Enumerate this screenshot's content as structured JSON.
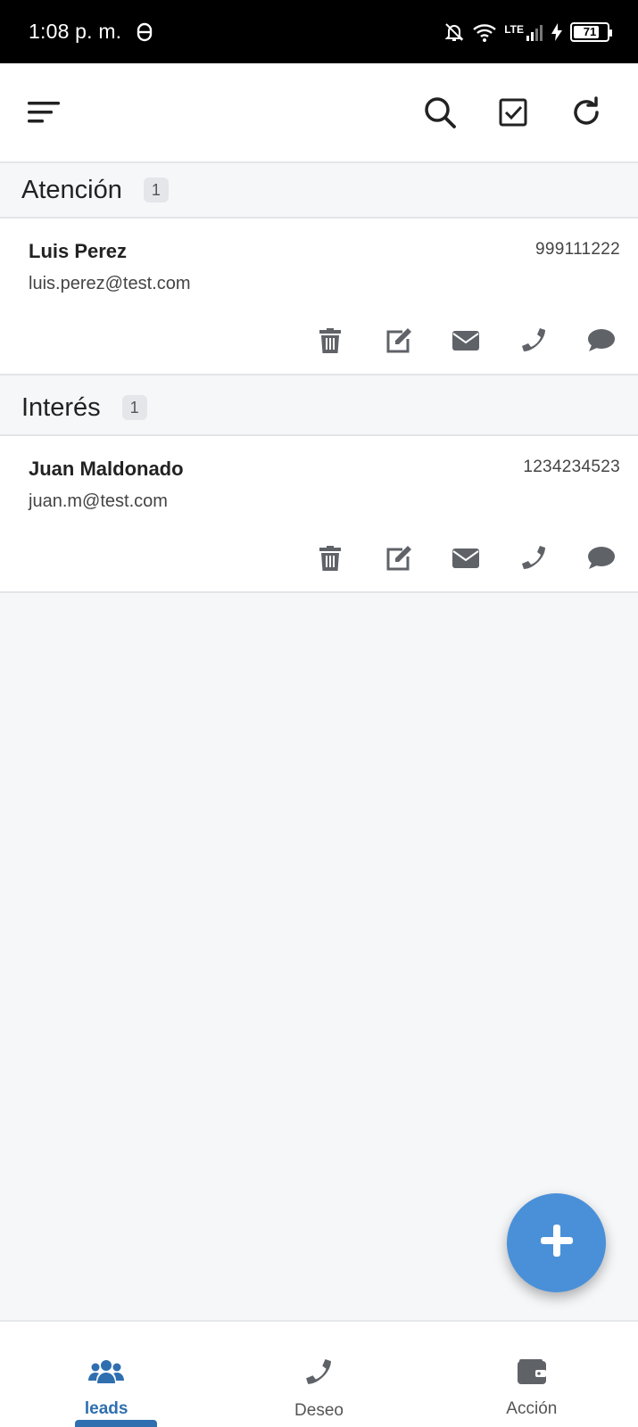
{
  "status_bar": {
    "time": "1:08 p. m.",
    "network": "LTE",
    "battery": "71"
  },
  "app_bar": {
    "menu_icon": "sort-menu-icon",
    "actions": [
      "search-icon",
      "checkbox-icon",
      "refresh-icon"
    ]
  },
  "sections": [
    {
      "title": "Atención",
      "count": "1",
      "leads": [
        {
          "name": "Luis Perez",
          "phone": "999111222",
          "email": "luis.perez@test.com"
        }
      ]
    },
    {
      "title": "Interés",
      "count": "1",
      "leads": [
        {
          "name": "Juan Maldonado",
          "phone": "1234234523",
          "email": "juan.m@test.com"
        }
      ]
    }
  ],
  "lead_actions": [
    "trash-icon",
    "edit-icon",
    "mail-icon",
    "phone-icon",
    "chat-icon"
  ],
  "fab": {
    "icon": "plus-icon"
  },
  "bottom_nav": {
    "items": [
      {
        "label": "leads",
        "icon": "users-icon",
        "active": true
      },
      {
        "label": "Deseo",
        "icon": "phone-icon",
        "active": false
      },
      {
        "label": "Acción",
        "icon": "wallet-icon",
        "active": false
      }
    ]
  },
  "colors": {
    "accent": "#4a90d9",
    "nav_active": "#2f6fb0",
    "icon_gray": "#5f6368",
    "background": "#f6f7f9"
  }
}
